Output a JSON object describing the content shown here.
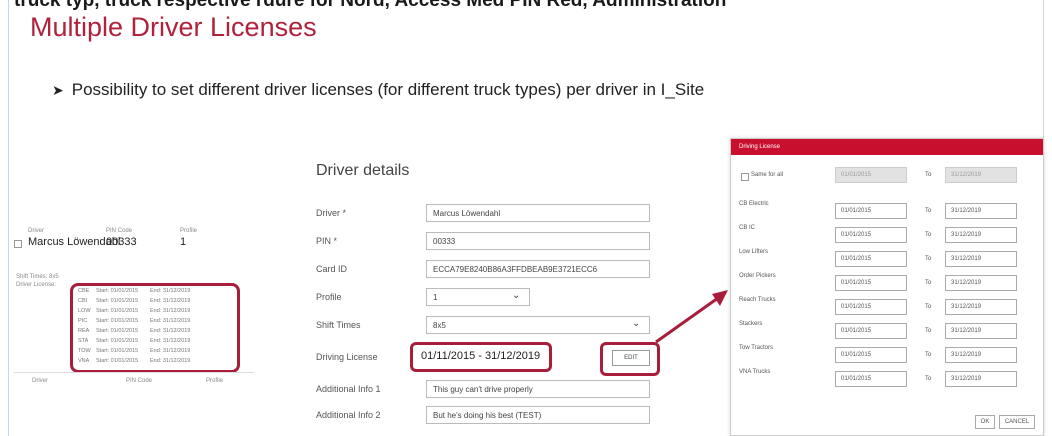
{
  "header": {
    "cut_text": "truck typ, truck respective rdure for Nord, Access Med PIN Red, Administration",
    "title": "Multiple Driver Licenses",
    "bullet": "Possibility to set different driver licenses (for different truck types) per driver in I_Site"
  },
  "card": {
    "col_driver": "Driver",
    "col_pin": "PIN Code",
    "col_profile": "Profile",
    "driver_name": "Marcus Löwendahl",
    "pin": "00333",
    "profile": "1",
    "shift_times_label": "Shift Times: 8x5",
    "driver_license_label": "Driver License:",
    "licenses": [
      {
        "code": "CBE",
        "start": "Start: 01/01/2015",
        "end": "End: 31/12/2019"
      },
      {
        "code": "CBI",
        "start": "Start: 01/01/2015",
        "end": "End: 31/12/2019"
      },
      {
        "code": "LOW",
        "start": "Start: 01/01/2015",
        "end": "End: 31/12/2019"
      },
      {
        "code": "PIC",
        "start": "Start: 01/01/2015",
        "end": "End: 31/12/2019"
      },
      {
        "code": "REA",
        "start": "Start: 01/01/2015",
        "end": "End: 31/12/2019"
      },
      {
        "code": "STA",
        "start": "Start: 01/01/2015",
        "end": "End: 31/12/2019"
      },
      {
        "code": "TOW",
        "start": "Start: 01/01/2015",
        "end": "End: 31/12/2019"
      },
      {
        "code": "VNA",
        "start": "Start: 01/01/2015",
        "end": "End: 31/12/2019"
      }
    ],
    "bottom_col_driver": "Driver",
    "bottom_col_pin": "PIN Code",
    "bottom_col_profile": "Profile"
  },
  "form": {
    "title": "Driver details",
    "driver_label": "Driver *",
    "driver_value": "Marcus Löwendahl",
    "pin_label": "PIN *",
    "pin_value": "00333",
    "card_label": "Card ID",
    "card_value": "ECCA79E8240B86A3FFDBEAB9E3721ECC6",
    "profile_label": "Profile",
    "profile_value": "1",
    "shift_label": "Shift Times",
    "shift_value": "8x5",
    "license_label": "Driving License",
    "license_value": "01/11/2015 - 31/12/2019",
    "edit_label": "EDIT",
    "info1_label": "Additional Info 1",
    "info1_value": "This guy can't drive properly",
    "info2_label": "Additional Info 2",
    "info2_value": "But he's doing his best (TEST)"
  },
  "dialog": {
    "title": "Driving License",
    "same_for_all": "Same for all",
    "same_from": "01/01/2015",
    "same_to": "31/12/2019",
    "to_label": "To",
    "rows": [
      {
        "label": "CB Electric",
        "from": "01/01/2015",
        "to": "31/12/2019"
      },
      {
        "label": "CB IC",
        "from": "01/01/2015",
        "to": "31/12/2019"
      },
      {
        "label": "Low Lifters",
        "from": "01/01/2015",
        "to": "31/12/2019"
      },
      {
        "label": "Order Pickers",
        "from": "01/01/2015",
        "to": "31/12/2019"
      },
      {
        "label": "Reach Trucks",
        "from": "01/01/2015",
        "to": "31/12/2019"
      },
      {
        "label": "Stackers",
        "from": "01/01/2015",
        "to": "31/12/2019"
      },
      {
        "label": "Tow Tractors",
        "from": "01/01/2015",
        "to": "31/12/2019"
      },
      {
        "label": "VNA Trucks",
        "from": "01/01/2015",
        "to": "31/12/2019"
      }
    ],
    "ok": "OK",
    "cancel": "CANCEL"
  },
  "colors": {
    "accent": "#b0213c",
    "dialog_header": "#c8102e",
    "highlight": "#a81d3a"
  }
}
